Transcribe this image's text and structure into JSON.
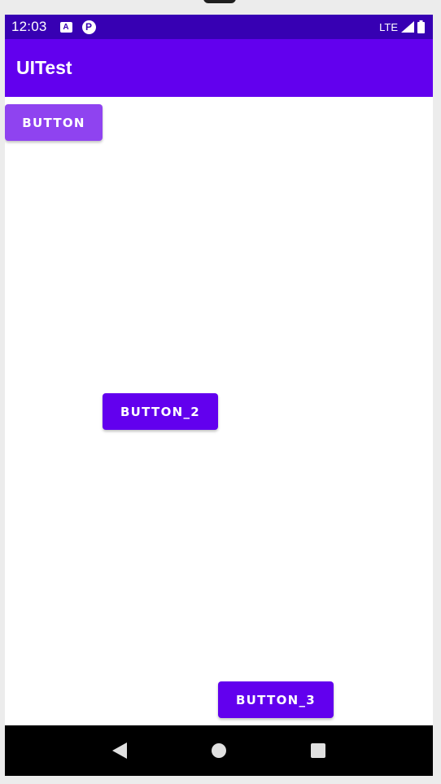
{
  "status_bar": {
    "time": "12:03",
    "notification_a": "A",
    "notification_p": "P",
    "network": "LTE",
    "icons": [
      "signal-icon",
      "battery-icon"
    ]
  },
  "app_bar": {
    "title": "UITest",
    "color": "#6200ee"
  },
  "buttons": {
    "button_1": "BUTTON",
    "button_2": "BUTTON_2",
    "button_3": "BUTTON_3"
  },
  "nav_bar": {
    "icons": [
      "back-icon",
      "home-icon",
      "recents-icon"
    ]
  },
  "colors": {
    "status_bar": "#3700b3",
    "primary": "#6200ee",
    "button_pressed": "#8f43f0"
  }
}
